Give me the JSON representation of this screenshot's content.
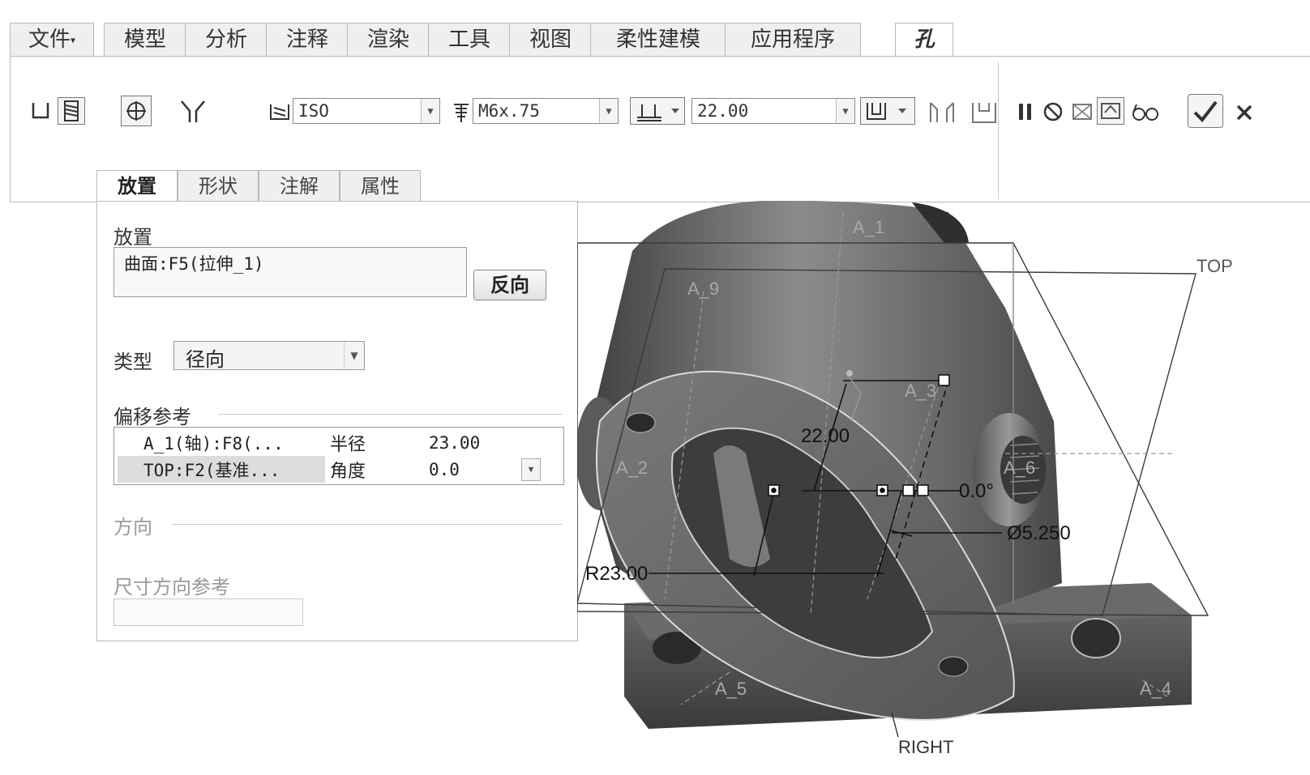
{
  "ribbon_tabs": [
    {
      "label": "文件"
    },
    {
      "label": "模型"
    },
    {
      "label": "分析"
    },
    {
      "label": "注释"
    },
    {
      "label": "渲染"
    },
    {
      "label": "工具"
    },
    {
      "label": "视图"
    },
    {
      "label": "柔性建模"
    },
    {
      "label": "应用程序"
    },
    {
      "label": "孔",
      "active": true
    }
  ],
  "toolbar": {
    "standard_value": "ISO",
    "screw_size_value": "M6x.75",
    "depth_value": "22.00",
    "icons": [
      "simple-hole-icon",
      "standard-hole-icon",
      "tapped-hole-icon",
      "drill-tip-icon",
      "standard-icon",
      "screw-size-icon",
      "blind-depth-icon",
      "countersink-icon",
      "counterbore-icon",
      "pause-icon",
      "no-preview-icon",
      "preview-icon",
      "verify-icon",
      "glasses-icon",
      "confirm-icon",
      "cancel-icon"
    ]
  },
  "sub_tabs": [
    {
      "label": "放置",
      "active": true
    },
    {
      "label": "形状"
    },
    {
      "label": "注解"
    },
    {
      "label": "属性"
    }
  ],
  "placement": {
    "section_label": "放置",
    "surface_ref": "曲面:F5(拉伸_1)",
    "flip_button": "反向",
    "type_label": "类型",
    "type_value": "径向",
    "offset_refs_label": "偏移参考",
    "offset_rows": [
      {
        "ref": "A_1(轴):F8(...",
        "kind": "半径",
        "value": "23.00"
      },
      {
        "ref": "TOP:F2(基准...",
        "kind": "角度",
        "value": "0.0"
      }
    ],
    "direction_label": "方向",
    "dim_dir_label": "尺寸方向参考"
  },
  "viewport": {
    "datum_labels": [
      "A_1",
      "A_9",
      "TOP",
      "A_3",
      "A_2",
      "A_6",
      "A_5",
      "A_4",
      "RIGHT"
    ],
    "dims": {
      "depth": "22.00",
      "angle": "0.0°",
      "diameter": "Ø5.250",
      "radius": "R23.00"
    }
  }
}
